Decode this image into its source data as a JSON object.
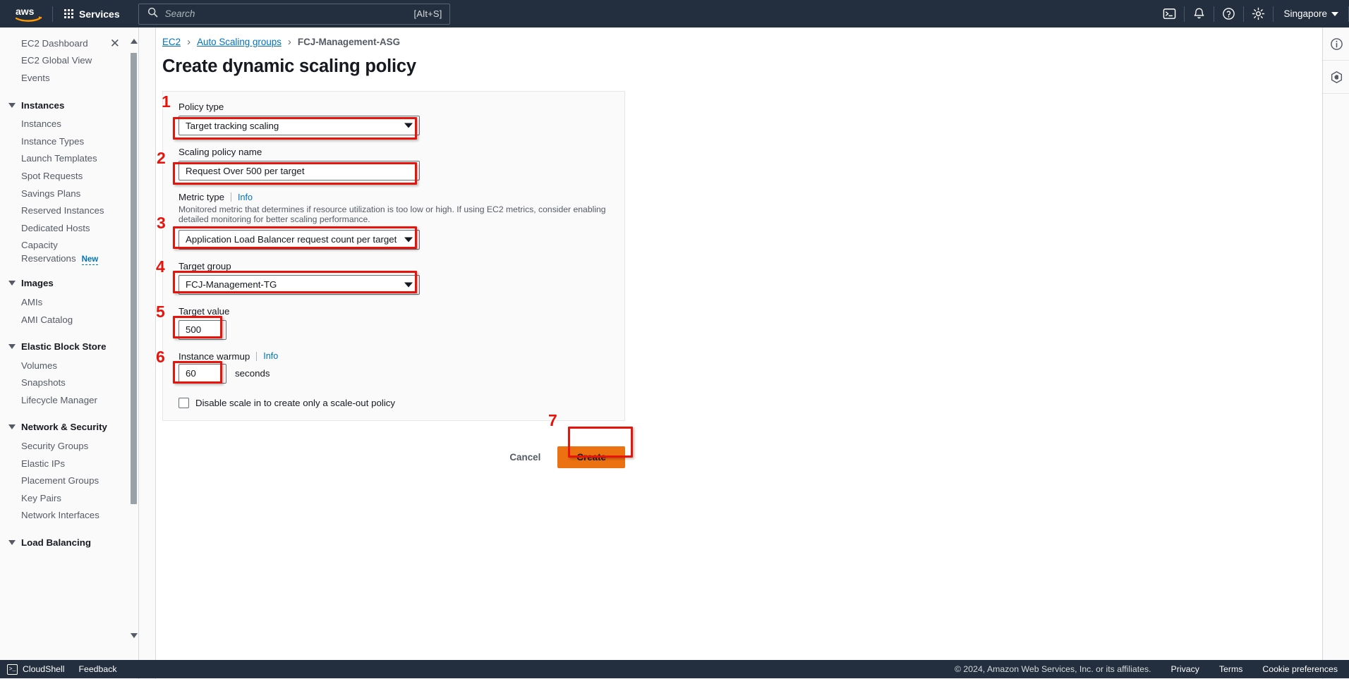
{
  "topnav": {
    "logo": "aws-logo",
    "services_label": "Services",
    "search": {
      "placeholder": "Search",
      "value": "",
      "shortcut": "[Alt+S]"
    },
    "icons": [
      "cloudshell-icon",
      "notifications-bell-icon",
      "help-question-icon",
      "settings-gear-icon"
    ],
    "region": "Singapore"
  },
  "sidebar": {
    "close_label": "✕",
    "items": [
      {
        "label": "EC2 Dashboard",
        "type": "link",
        "closable": true
      },
      {
        "label": "EC2 Global View",
        "type": "link"
      },
      {
        "label": "Events",
        "type": "link"
      },
      {
        "label": "Instances",
        "type": "group"
      },
      {
        "label": "Instances",
        "type": "link"
      },
      {
        "label": "Instance Types",
        "type": "link"
      },
      {
        "label": "Launch Templates",
        "type": "link"
      },
      {
        "label": "Spot Requests",
        "type": "link"
      },
      {
        "label": "Savings Plans",
        "type": "link"
      },
      {
        "label": "Reserved Instances",
        "type": "link"
      },
      {
        "label": "Dedicated Hosts",
        "type": "link"
      },
      {
        "label": "Capacity Reservations",
        "type": "link",
        "badge": "New"
      },
      {
        "label": "Images",
        "type": "group"
      },
      {
        "label": "AMIs",
        "type": "link"
      },
      {
        "label": "AMI Catalog",
        "type": "link"
      },
      {
        "label": "Elastic Block Store",
        "type": "group"
      },
      {
        "label": "Volumes",
        "type": "link"
      },
      {
        "label": "Snapshots",
        "type": "link"
      },
      {
        "label": "Lifecycle Manager",
        "type": "link"
      },
      {
        "label": "Network & Security",
        "type": "group"
      },
      {
        "label": "Security Groups",
        "type": "link"
      },
      {
        "label": "Elastic IPs",
        "type": "link"
      },
      {
        "label": "Placement Groups",
        "type": "link"
      },
      {
        "label": "Key Pairs",
        "type": "link"
      },
      {
        "label": "Network Interfaces",
        "type": "link"
      },
      {
        "label": "Load Balancing",
        "type": "group"
      }
    ]
  },
  "breadcrumb": {
    "items": [
      {
        "label": "EC2",
        "link": true
      },
      {
        "label": "Auto Scaling groups",
        "link": true
      },
      {
        "label": "FCJ-Management-ASG",
        "link": false
      }
    ],
    "separator": "›"
  },
  "page": {
    "title": "Create dynamic scaling policy"
  },
  "form": {
    "policy_type": {
      "label": "Policy type",
      "value": "Target tracking scaling",
      "step": "1"
    },
    "policy_name": {
      "label": "Scaling policy name",
      "value": "Request Over 500 per target",
      "step": "2"
    },
    "metric_type": {
      "label": "Metric type",
      "info": "Info",
      "description": "Monitored metric that determines if resource utilization is too low or high. If using EC2 metrics, consider enabling detailed monitoring for better scaling performance.",
      "value": "Application Load Balancer request count per target",
      "step": "3"
    },
    "target_group": {
      "label": "Target group",
      "value": "FCJ-Management-TG",
      "step": "4"
    },
    "target_value": {
      "label": "Target value",
      "value": "500",
      "step": "5"
    },
    "instance_warmup": {
      "label": "Instance warmup",
      "info": "Info",
      "value": "60",
      "unit": "seconds",
      "step": "6"
    },
    "disable_scale_in": {
      "label": "Disable scale in to create only a scale-out policy",
      "checked": false
    }
  },
  "actions": {
    "cancel_label": "Cancel",
    "create_label": "Create",
    "step": "7"
  },
  "rail": {
    "icons": [
      "info-circle-icon",
      "settings-hexagon-icon"
    ]
  },
  "footer": {
    "cloudshell_label": "CloudShell",
    "feedback_label": "Feedback",
    "copyright": "© 2024, Amazon Web Services, Inc. or its affiliates.",
    "links": [
      "Privacy",
      "Terms",
      "Cookie preferences"
    ]
  },
  "colors": {
    "nav_bg": "#232f3e",
    "accent_orange": "#ec7211",
    "link_blue": "#0073bb",
    "highlight_red": "#e8140c",
    "panel_bg": "#fafafa"
  }
}
